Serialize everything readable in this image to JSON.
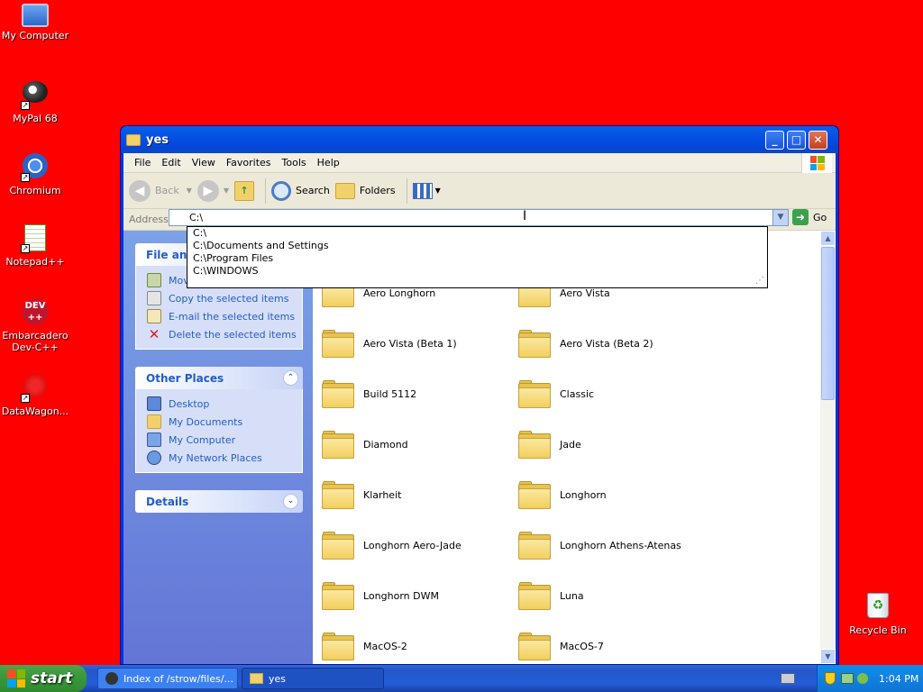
{
  "desktop": {
    "icons": [
      {
        "label": "My Computer"
      },
      {
        "label": "MyPal 68"
      },
      {
        "label": "Chromium"
      },
      {
        "label": "Notepad++"
      },
      {
        "label": "Embarcadero Dev-C++"
      },
      {
        "label": "DataWagon..."
      },
      {
        "label": "Recycle Bin"
      }
    ],
    "background_color": "#ff0000"
  },
  "window": {
    "title": "yes",
    "menu": [
      "File",
      "Edit",
      "View",
      "Favorites",
      "Tools",
      "Help"
    ],
    "toolbar": {
      "back": "Back",
      "search": "Search",
      "folders": "Folders"
    },
    "address": {
      "label": "Address",
      "value": "C:\\",
      "go": "Go"
    },
    "autocomplete": [
      "C:\\",
      "C:\\Documents and Settings",
      "C:\\Program Files",
      "C:\\WINDOWS"
    ],
    "tasks": {
      "file_folder_tasks": {
        "title": "File and",
        "items": [
          "Move",
          "Copy the selected items",
          "E-mail the selected items",
          "Delete the selected items"
        ]
      },
      "other_places": {
        "title": "Other Places",
        "items": [
          "Desktop",
          "My Documents",
          "My Computer",
          "My Network Places"
        ]
      },
      "details": {
        "title": "Details"
      }
    },
    "folders": [
      "Aero Longhorn",
      "Aero Vista",
      "Aero Vista (Beta 1)",
      "Aero Vista (Beta 2)",
      "Build 5112",
      "Classic",
      "Diamond",
      "Jade",
      "Klarheit",
      "Longhorn",
      "Longhorn Aero-Jade",
      "Longhorn Athens-Atenas",
      "Longhorn DWM",
      "Luna",
      "MacOS-2",
      "MacOS-7"
    ]
  },
  "taskbar": {
    "start": "start",
    "tasks": [
      "Index of /strow/files/...",
      "yes"
    ],
    "time": "1:04 PM"
  }
}
